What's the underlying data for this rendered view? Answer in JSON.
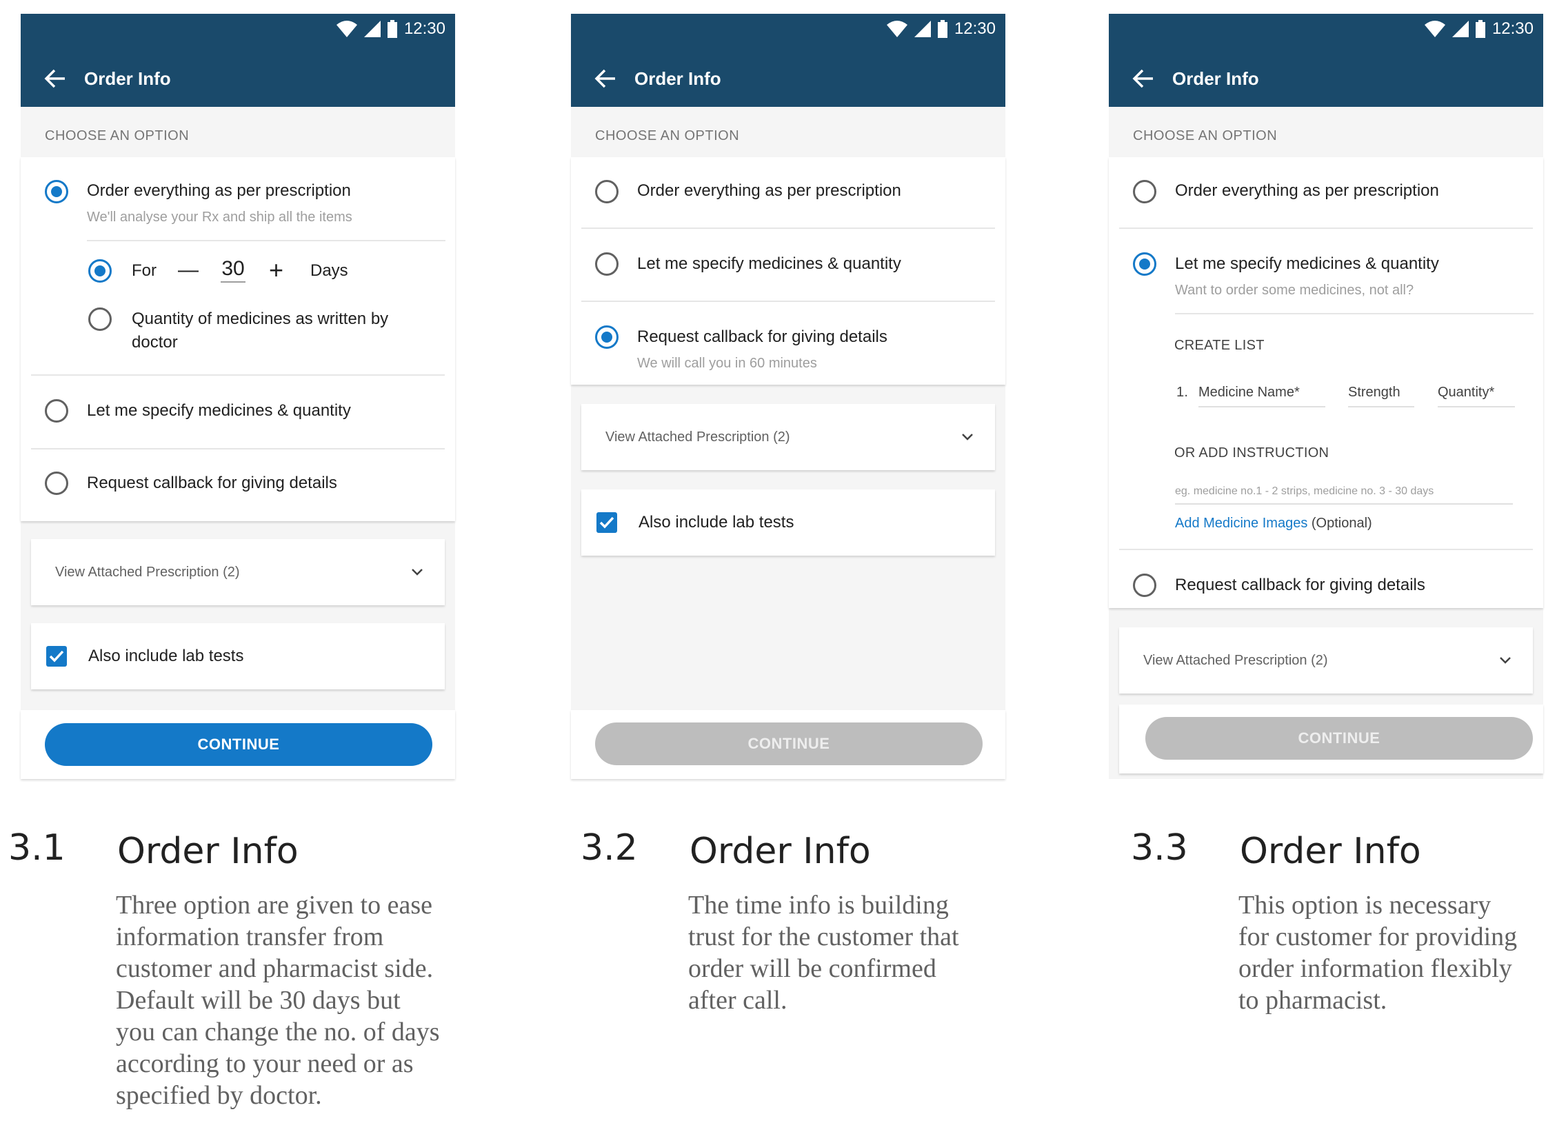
{
  "status": {
    "time": "12:30"
  },
  "appbar": {
    "title": "Order Info"
  },
  "section": {
    "label": "CHOOSE AN OPTION"
  },
  "options": {
    "order_all": "Order everything as per prescription",
    "order_all_sub": "We'll analyse your Rx and ship all the items",
    "specify": "Let me specify medicines & quantity",
    "specify_sub": "Want to order some medicines, not all?",
    "callback": "Request callback for giving details",
    "callback_sub": "We will call you in 60 minutes"
  },
  "duration": {
    "for_label": "For",
    "minus": "—",
    "value": "30",
    "plus": "+",
    "unit": "Days",
    "qty_option": "Quantity of medicines as written by doctor"
  },
  "prescription": {
    "label": "View Attached Prescription (2)"
  },
  "lab": {
    "label": "Also include lab tests"
  },
  "continue": {
    "label": "CONTINUE"
  },
  "create_list": {
    "heading": "CREATE LIST",
    "index": "1.",
    "name_field": "Medicine Name*",
    "strength_field": "Strength",
    "quantity_field": "Quantity*",
    "or_heading": "OR ADD INSTRUCTION",
    "instruction_placeholder": "eg. medicine no.1 - 2 strips, medicine no. 3 - 30 days",
    "add_images": "Add Medicine Images",
    "optional": "(Optional)"
  },
  "captions": [
    {
      "num": "3.1",
      "title": "Order Info",
      "body": "Three option are given to ease information transfer from customer and pharmacist side. Default will be 30 days but you can change the no. of days according to your need or as specified by doctor."
    },
    {
      "num": "3.2",
      "title": "Order Info",
      "body": "The time info is building trust for the customer that order will be confirmed after call."
    },
    {
      "num": "3.3",
      "title": "Order Info",
      "body": "This option is necessary for customer for providing order information flexibly to pharmacist."
    }
  ],
  "colors": {
    "appbar": "#1a4a6b",
    "accent": "#1479c8",
    "disabled": "#bdbdbd"
  }
}
